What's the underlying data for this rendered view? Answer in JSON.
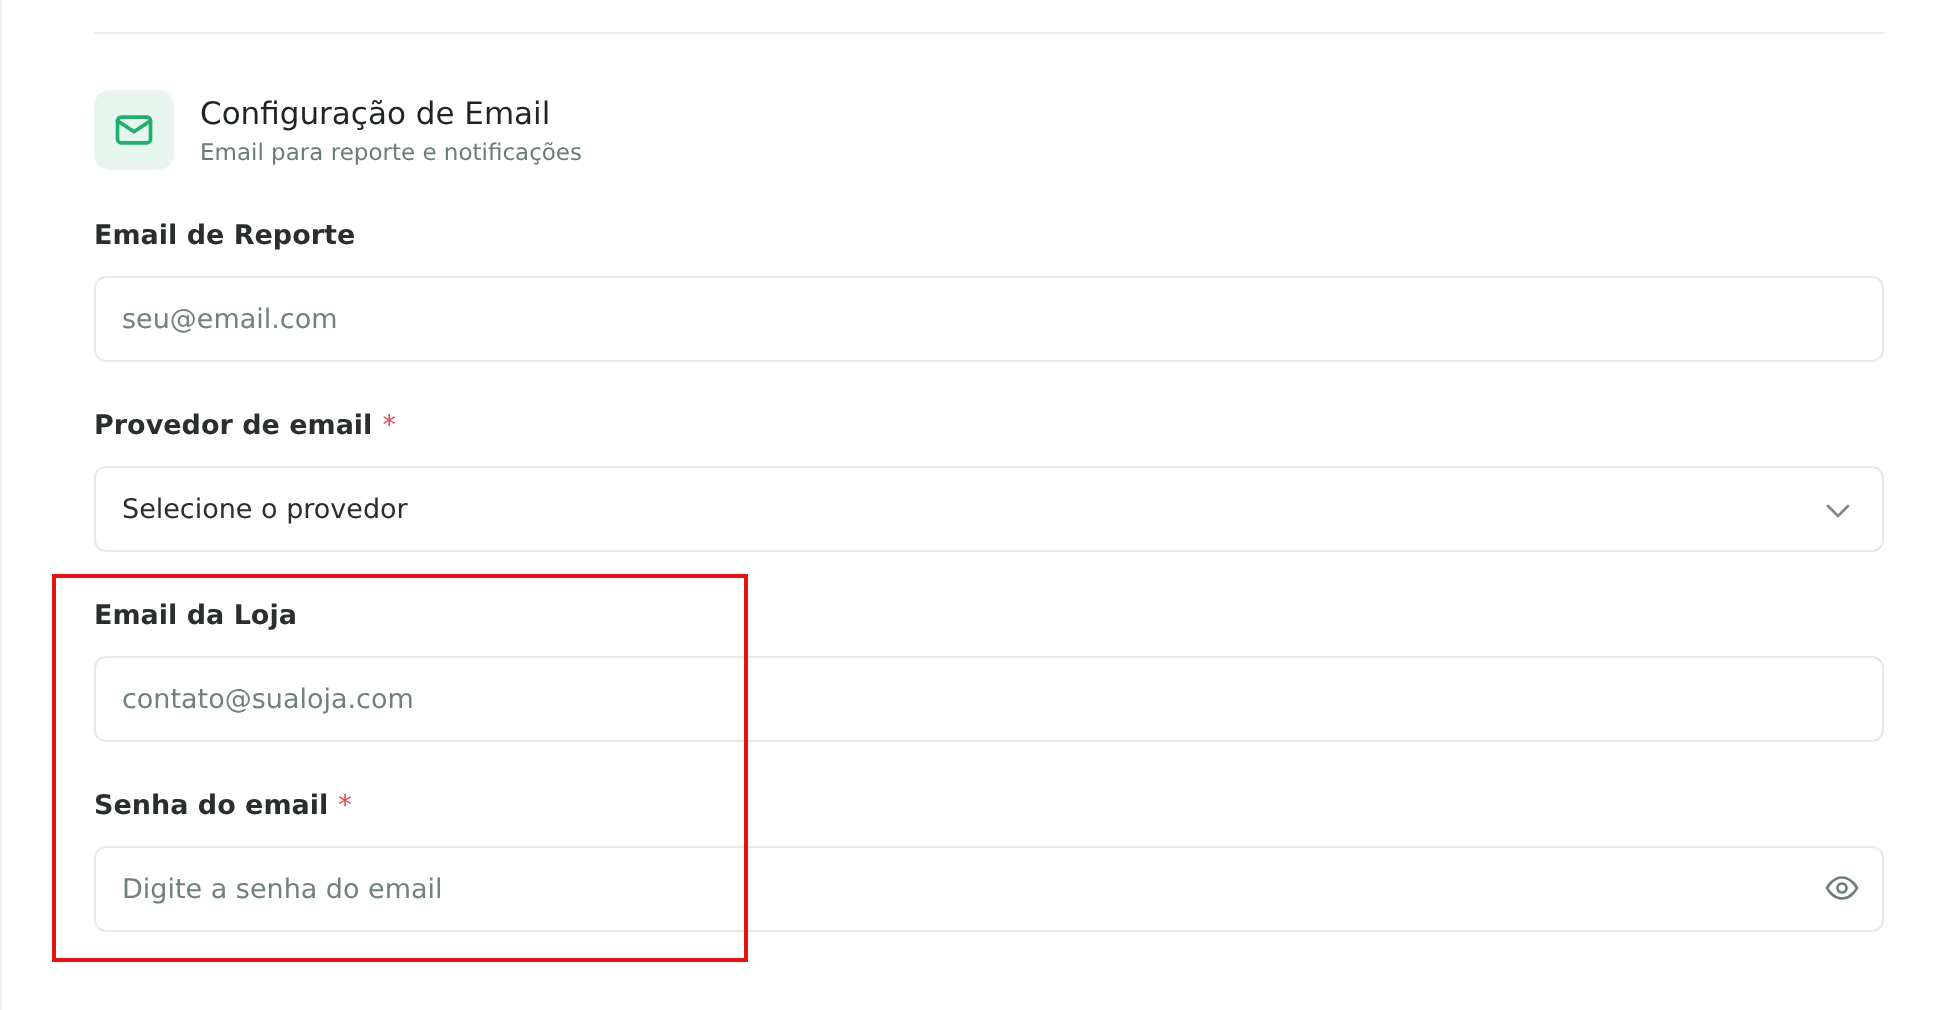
{
  "section": {
    "title": "Configuração de Email",
    "subtitle": "Email para reporte e notificações"
  },
  "fields": [
    {
      "kind": "text",
      "label": "Email de Reporte",
      "placeholder": "seu@email.com",
      "highlighted": false
    },
    {
      "kind": "select",
      "label": "Provedor de email",
      "required_mark": "*",
      "value": "Selecione o provedor",
      "highlighted": false
    },
    {
      "kind": "text",
      "label": "Email da Loja",
      "placeholder": "contato@sualoja.com",
      "highlighted": true
    },
    {
      "kind": "password",
      "label": "Senha do email",
      "required_mark": "*",
      "placeholder": "Digite a senha do email",
      "highlighted": true
    }
  ]
}
